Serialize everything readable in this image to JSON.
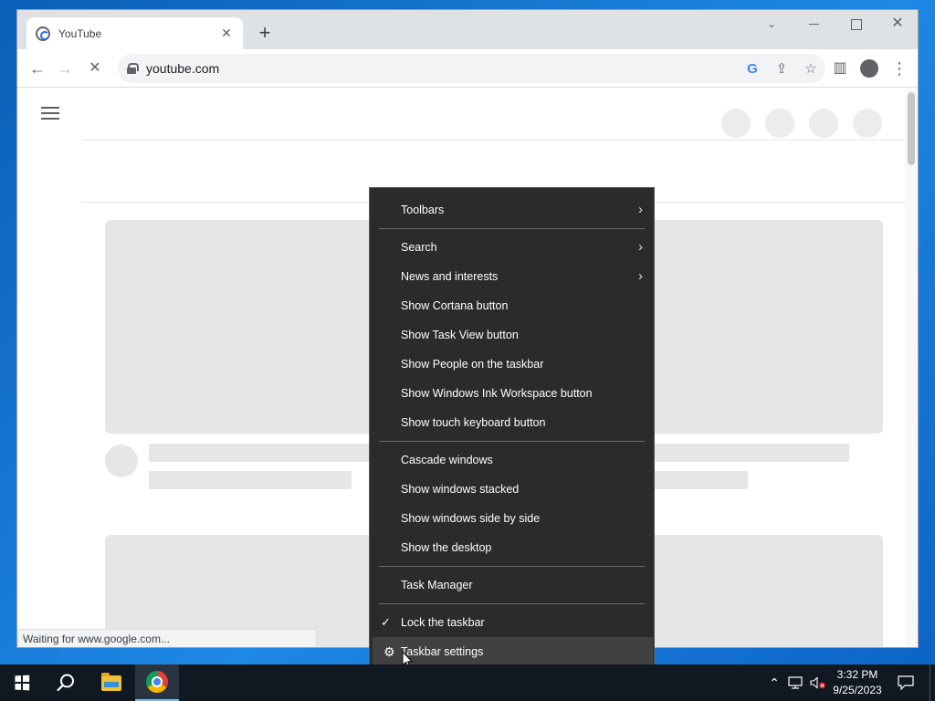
{
  "browser": {
    "tab_title": "YouTube",
    "tab_close_glyph": "✕",
    "new_tab_glyph": "+",
    "url": "youtube.com",
    "status_text": "Waiting for www.google.com...",
    "icons": [
      "back-icon",
      "forward-icon",
      "stop-icon",
      "lock-icon",
      "google-icon",
      "share-icon",
      "bookmark-star-icon",
      "side-panel-icon",
      "profile-icon",
      "menu-icon"
    ]
  },
  "context_menu": {
    "items": [
      {
        "label": "Toolbars",
        "submenu": true
      },
      {
        "label": "Search",
        "submenu": true
      },
      {
        "label": "News and interests",
        "submenu": true
      },
      {
        "label": "Show Cortana button"
      },
      {
        "label": "Show Task View button"
      },
      {
        "label": "Show People on the taskbar"
      },
      {
        "label": "Show Windows Ink Workspace button"
      },
      {
        "label": "Show touch keyboard button"
      },
      {
        "label": "Cascade windows"
      },
      {
        "label": "Show windows stacked"
      },
      {
        "label": "Show windows side by side"
      },
      {
        "label": "Show the desktop"
      },
      {
        "label": "Task Manager"
      },
      {
        "label": "Lock the taskbar",
        "checked": true
      },
      {
        "label": "Taskbar settings",
        "icon": "gear-icon",
        "hovered": true
      }
    ]
  },
  "taskbar": {
    "time": "3:32 PM",
    "date": "9/25/2023",
    "pinned": [
      "start-button",
      "search-button",
      "file-explorer",
      "google-chrome"
    ]
  },
  "colors": {
    "menu_bg": "#2b2b2b",
    "menu_hover": "#414141",
    "taskbar_bg": "#101821",
    "desktop": "#0a5fb8"
  }
}
